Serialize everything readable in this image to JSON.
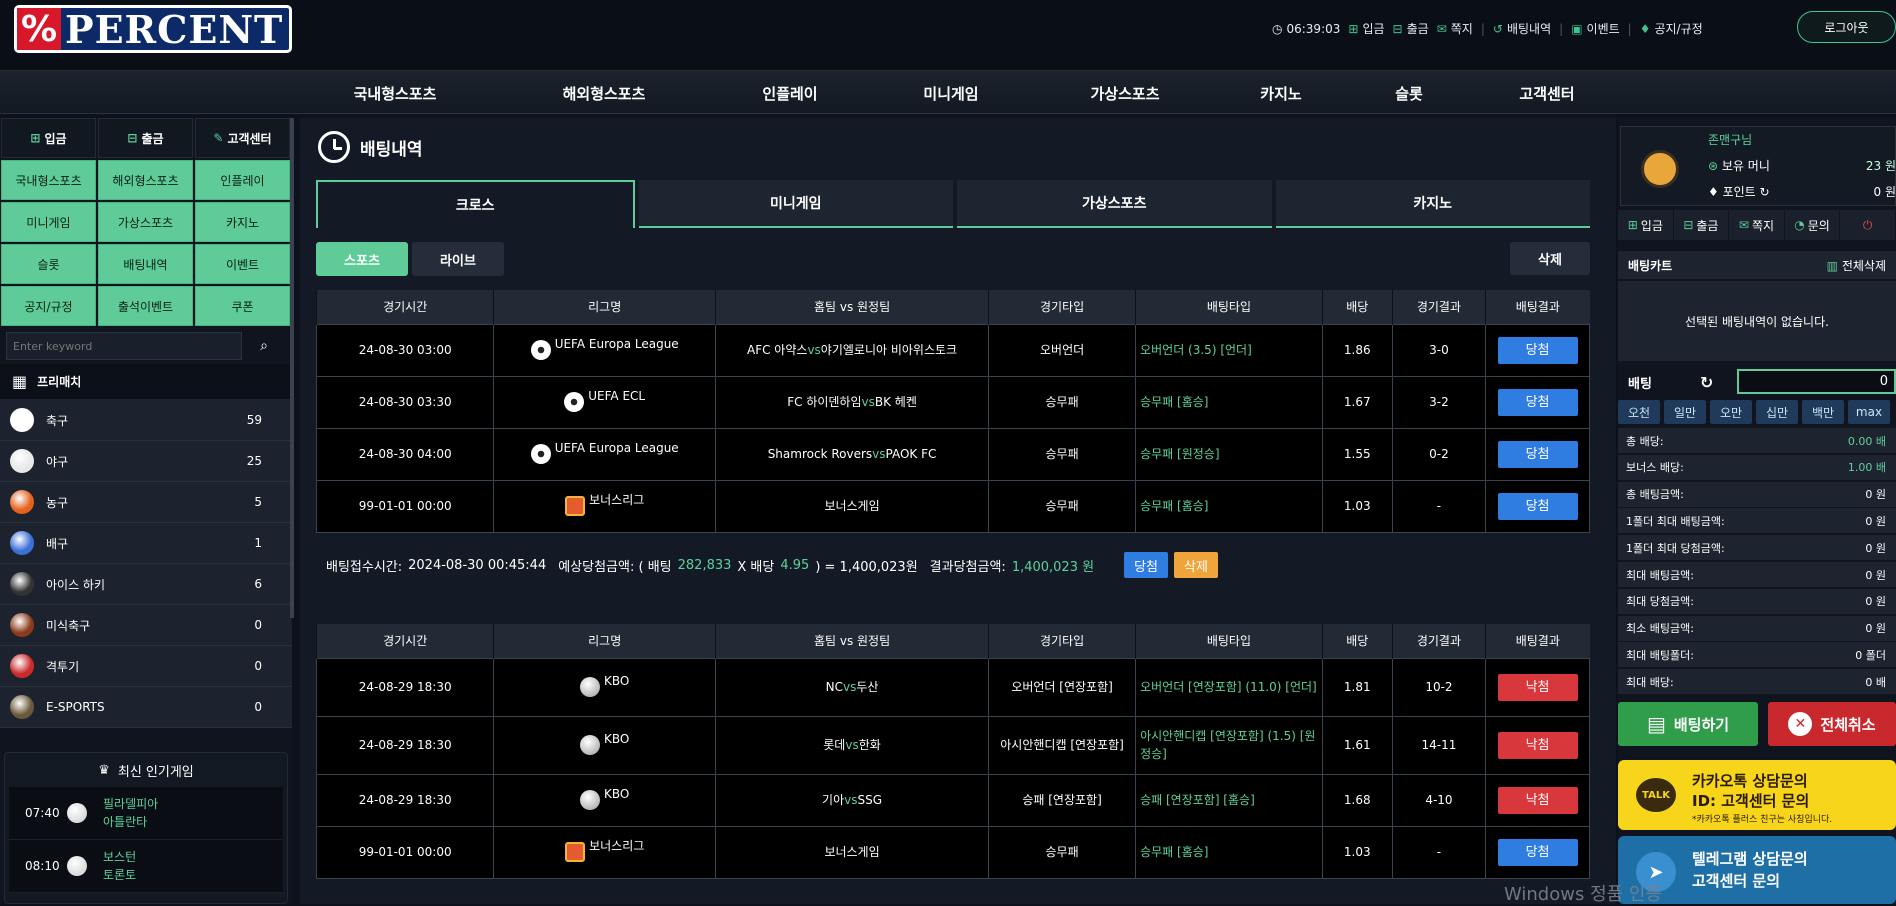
{
  "brand": {
    "name": "PERCENT",
    "mark": "%"
  },
  "topbar": {
    "time": "06:39:03",
    "links": [
      {
        "icon": "plus-icon",
        "label": "입금"
      },
      {
        "icon": "minus-icon",
        "label": "출금"
      },
      {
        "icon": "mail-icon",
        "label": "쪽지"
      },
      {
        "icon": "history-icon",
        "label": "배팅내역"
      },
      {
        "icon": "gift-icon",
        "label": "이벤트"
      },
      {
        "icon": "bell-icon",
        "label": "공지/규정"
      }
    ],
    "logout": "로그아웃"
  },
  "nav": [
    "국내형스포츠",
    "해외형스포츠",
    "인플레이",
    "미니게임",
    "가상스포츠",
    "카지노",
    "슬롯",
    "고객센터"
  ],
  "left": {
    "quick": [
      "입금",
      "출금",
      "고객센터"
    ],
    "grid": [
      "국내형스포츠",
      "해외형스포츠",
      "인플레이",
      "미니게임",
      "가상스포츠",
      "카지노",
      "슬롯",
      "배팅내역",
      "이벤트",
      "공지/규정",
      "출석이벤트",
      "쿠폰"
    ],
    "search_placeholder": "Enter keyword",
    "prematch": "프리매치",
    "sports": [
      {
        "name": "축구",
        "count": "59",
        "color": "#ffffff"
      },
      {
        "name": "야구",
        "count": "25",
        "color": "#e8e8e8"
      },
      {
        "name": "농구",
        "count": "5",
        "color": "#e5611e"
      },
      {
        "name": "배구",
        "count": "1",
        "color": "#3c6fd8"
      },
      {
        "name": "아이스 하키",
        "count": "6",
        "color": "#333333"
      },
      {
        "name": "미식축구",
        "count": "0",
        "color": "#8b3a1a"
      },
      {
        "name": "격투기",
        "count": "0",
        "color": "#c92a2a"
      },
      {
        "name": "E-SPORTS",
        "count": "0",
        "color": "#6a5a3a"
      }
    ],
    "popular": {
      "title": "최신 인기게임",
      "items": [
        {
          "time": "07:40",
          "home": "필라델피아",
          "away": "아틀란타"
        },
        {
          "time": "08:10",
          "home": "보스턴",
          "away": "토론토"
        }
      ]
    }
  },
  "page": {
    "title": "배팅내역",
    "tabs": [
      "크로스",
      "미니게임",
      "가상스포츠",
      "카지노"
    ],
    "subtabs": [
      "스포츠",
      "라이브"
    ],
    "delete": "삭제",
    "headers": [
      "경기시간",
      "리그명",
      "홈팀 vs 원정팀",
      "경기타입",
      "배팅타입",
      "배당",
      "경기결과",
      "배팅결과"
    ],
    "slips": [
      {
        "rows": [
          {
            "time": "24-08-30 03:00",
            "icon": "soccer",
            "league": "UEFA Europa League",
            "home": "AFC 아약스",
            "away": "야기엘로니아 비아위스토크",
            "gtype": "오버언더",
            "btype": "오버언더 (3.5) [언더]",
            "odds": "1.86",
            "score": "3-0",
            "result": "당첨",
            "win": true
          },
          {
            "time": "24-08-30 03:30",
            "icon": "soccer",
            "league": "UEFA ECL",
            "home": "FC 하이덴하임",
            "away": "BK 헤켄",
            "gtype": "승무패",
            "btype": "승무패 [홈승]",
            "odds": "1.67",
            "score": "3-2",
            "result": "당첨",
            "win": true
          },
          {
            "time": "24-08-30 04:00",
            "icon": "soccer",
            "league": "UEFA Europa League",
            "home": "Shamrock Rovers",
            "away": "PAOK FC",
            "gtype": "승무패",
            "btype": "승무패 [원정승]",
            "odds": "1.55",
            "score": "0-2",
            "result": "당첨",
            "win": true
          },
          {
            "time": "99-01-01 00:00",
            "icon": "gift",
            "league": "보너스리그",
            "home": "보너스게임",
            "away": "",
            "gtype": "승무패",
            "btype": "승무패 [홈승]",
            "odds": "1.03",
            "score": "-",
            "result": "당첨",
            "win": true
          }
        ],
        "summary": {
          "label_time": "배팅접수시간:",
          "time": "2024-08-30 00:45:44",
          "label_expected": "예상당첨금액: ( 배팅",
          "stake": "282,833",
          "x": "X 배당",
          "odds": "4.95",
          "eq": ") = 1,400,023원",
          "label_result": "결과당첨금액:",
          "result_amount": "1,400,023 원",
          "btn_result": "당첨",
          "btn_delete": "삭제"
        }
      },
      {
        "rows": [
          {
            "time": "24-08-29 18:30",
            "icon": "baseball",
            "league": "KBO",
            "home": "NC",
            "away": "두산",
            "gtype": "오버언더 [연장포함]",
            "btype": "오버언더 [연장포함] (11.0) [언더]",
            "odds": "1.81",
            "score": "10-2",
            "result": "낙첨",
            "win": false
          },
          {
            "time": "24-08-29 18:30",
            "icon": "baseball",
            "league": "KBO",
            "home": "롯데",
            "away": "한화",
            "gtype": "아시안핸디캡 [연장포함]",
            "btype": "아시안핸디캡 [연장포함] (1.5) [원정승]",
            "odds": "1.61",
            "score": "14-11",
            "result": "낙첨",
            "win": false
          },
          {
            "time": "24-08-29 18:30",
            "icon": "baseball",
            "league": "KBO",
            "home": "기아",
            "away": "SSG",
            "gtype": "승패 [연장포함]",
            "btype": "승패 [연장포함] [홈승]",
            "odds": "1.68",
            "score": "4-10",
            "result": "낙첨",
            "win": false
          },
          {
            "time": "99-01-01 00:00",
            "icon": "gift",
            "league": "보너스리그",
            "home": "보너스게임",
            "away": "",
            "gtype": "승무패",
            "btype": "승무패 [홈승]",
            "odds": "1.03",
            "score": "-",
            "result": "당첨",
            "win": true
          }
        ]
      }
    ]
  },
  "right": {
    "user": "존맨구님",
    "money_label": "보유 머니",
    "money": "23 원",
    "point_label": "포인트",
    "point": "0 원",
    "actions": [
      "입금",
      "출금",
      "쪽지",
      "문의"
    ],
    "cart_title": "배팅카트",
    "cart_clear": "전체삭제",
    "cart_empty": "선택된 배팅내역이 없습니다.",
    "bet_label": "배팅",
    "bet_value": "0",
    "chips": [
      "오천",
      "일만",
      "오만",
      "십만",
      "백만",
      "max"
    ],
    "info": [
      {
        "label": "총 배당:",
        "value": "0.00 배",
        "green": true
      },
      {
        "label": "보너스 배당:",
        "value": "1.00 배",
        "green": true
      },
      {
        "label": "총 배팅금액:",
        "value": "0 원",
        "green": false
      },
      {
        "label": "1폴더 최대 배팅금액:",
        "value": "0 원",
        "green": false
      },
      {
        "label": "1폴더 최대 당첨금액:",
        "value": "0 원",
        "green": false
      },
      {
        "label": "최대 배팅금액:",
        "value": "0 원",
        "green": false
      },
      {
        "label": "최대 당첨금액:",
        "value": "0 원",
        "green": false
      },
      {
        "label": "최소 배팅금액:",
        "value": "0 원",
        "green": false
      },
      {
        "label": "최대 배팅폴더:",
        "value": "0 폴더",
        "green": false
      },
      {
        "label": "최대 배당:",
        "value": "0 배",
        "green": false
      }
    ],
    "bet_btn": "배팅하기",
    "cancel_btn": "전체취소",
    "kakao": {
      "badge": "TALK",
      "line1": "카카오톡 상담문의",
      "line2": "ID: 고객센터 문의",
      "line3": "*카카오톡 플러스 친구는 사칭입니다."
    },
    "tele": {
      "line1": "텔레그램 상담문의",
      "line2": "고객센터 문의"
    }
  },
  "watermark": "Windows 정품 인증"
}
